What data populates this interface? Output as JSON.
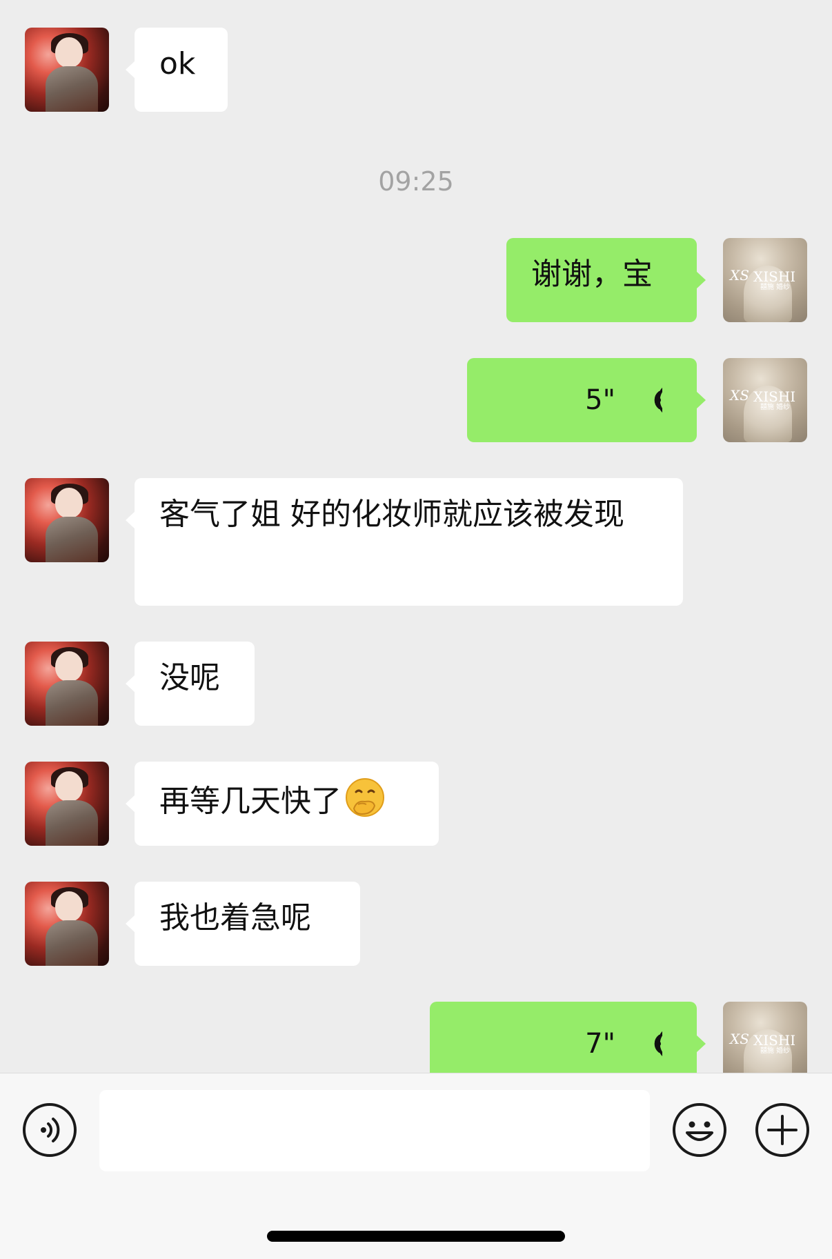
{
  "timestamp": "09:25",
  "messages": {
    "m1": {
      "direction": "in",
      "text": "ok"
    },
    "m2": {
      "direction": "out",
      "text": "谢谢，宝"
    },
    "m3": {
      "direction": "out",
      "type": "voice",
      "duration": "5\""
    },
    "m4": {
      "direction": "in",
      "text": "客气了姐 好的化妆师就应该被发现"
    },
    "m5": {
      "direction": "in",
      "text": "没呢"
    },
    "m6": {
      "direction": "in",
      "text": "再等几天快了",
      "emoji": "thinking-hand-over-mouth-emoji"
    },
    "m7": {
      "direction": "in",
      "text": "我也着急呢"
    },
    "m8": {
      "direction": "out",
      "type": "voice",
      "duration": "7\""
    }
  },
  "self_avatar": {
    "logo_mark": "XS",
    "logo_text": "XISHI",
    "logo_sub": "囍施 婚纱"
  },
  "input_bar": {
    "voice_button_icon": "voice-mode-icon",
    "input_value": "",
    "emoji_button_icon": "smiley-face-icon",
    "plus_button_icon": "plus-icon"
  },
  "colors": {
    "background": "#ededed",
    "incoming_bubble": "#ffffff",
    "outgoing_bubble": "#95ec69",
    "timestamp_text": "#a3a3a3"
  }
}
